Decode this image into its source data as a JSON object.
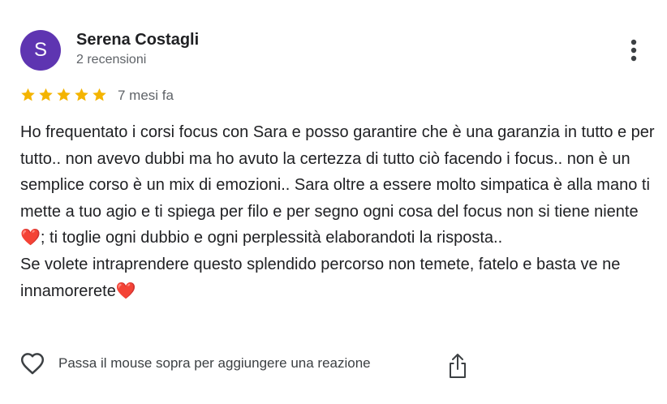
{
  "review": {
    "author": {
      "initial": "S",
      "name": "Serena Costagli",
      "meta": "2 recensioni",
      "avatar_color": "#5E35B1"
    },
    "rating": {
      "value": 5,
      "max": 5,
      "star_color": "#F4B400"
    },
    "date": "7 mesi fa",
    "text": "Ho frequentato i corsi focus con Sara e posso garantire che è una garanzia in tutto e per tutto.. non avevo dubbi ma ho avuto la certezza di tutto ciò facendo i focus.. non è un semplice corso è un mix di emozioni.. Sara oltre a essere molto simpatica è alla mano ti mette a tuo agio e ti spiega per filo e per segno ogni cosa del focus non si tiene niente❤️; ti toglie ogni dubbio e ogni perplessità elaborandoti la risposta..\nSe volete intraprendere questo splendido percorso non temete, fatelo e basta ve ne innamorerete❤️"
  },
  "actions": {
    "reaction_icon": "heart-outline-icon",
    "reaction_label": "Passa il mouse sopra per aggiungere una reazione",
    "share_icon": "share-icon",
    "more_icon": "more-vertical-icon"
  }
}
